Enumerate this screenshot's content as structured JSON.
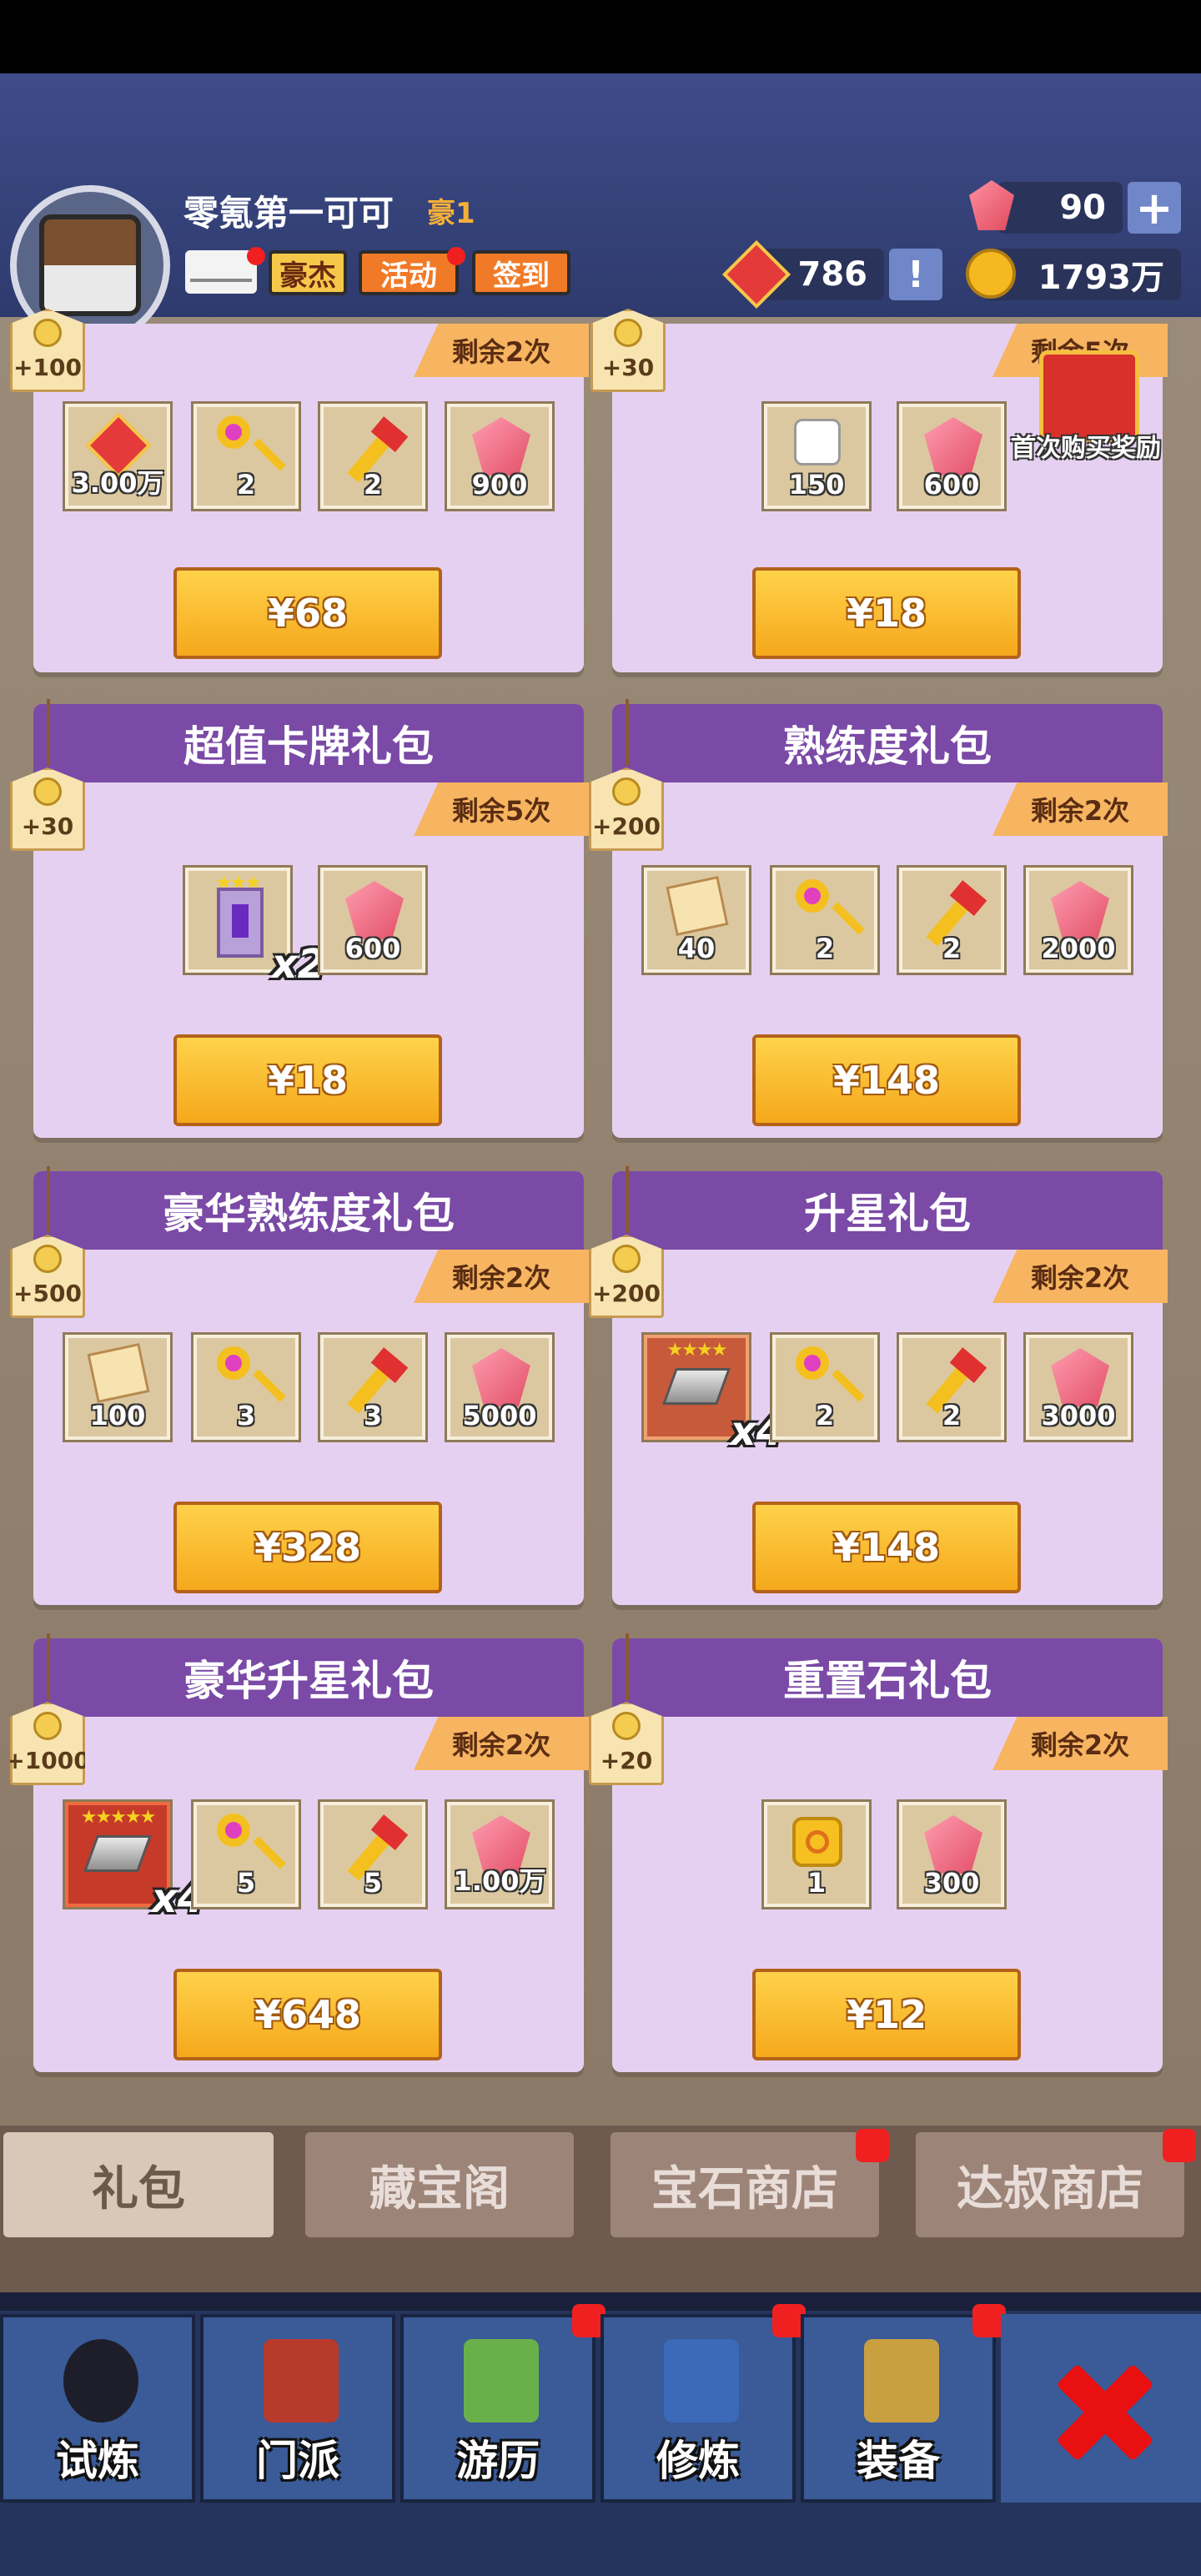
{
  "header": {
    "player_name": "零氪第一可可",
    "vip": "豪1",
    "buttons": {
      "haojie": "豪杰",
      "huodong": "活动",
      "qiandao": "签到"
    },
    "gems": "90",
    "honor": "786",
    "coins": "1793万"
  },
  "top_row": [
    {
      "tag": "+100",
      "remaining": "剩余2次",
      "items": [
        {
          "icon": "honor-icon",
          "qty": "3.00万"
        },
        {
          "icon": "pink-key-icon",
          "qty": "2"
        },
        {
          "icon": "gold-key-icon",
          "qty": "2"
        },
        {
          "icon": "gem-icon",
          "qty": "900"
        }
      ],
      "price": "¥68"
    },
    {
      "tag": "+30",
      "remaining": "剩余5次",
      "items": [
        {
          "icon": "dice-icon",
          "qty": "150"
        },
        {
          "icon": "gem-icon",
          "qty": "600"
        }
      ],
      "price": "¥18",
      "bonus_label": "首次购买奖励"
    }
  ],
  "packs": [
    {
      "title": "超值卡牌礼包",
      "tag": "+30",
      "remaining": "剩余5次",
      "items": [
        {
          "icon": "card-icon",
          "qty": "",
          "mult": "x2"
        },
        {
          "icon": "gem-icon",
          "qty": "600"
        }
      ],
      "price": "¥18"
    },
    {
      "title": "熟练度礼包",
      "tag": "+200",
      "remaining": "剩余2次",
      "items": [
        {
          "icon": "scroll-icon",
          "qty": "40"
        },
        {
          "icon": "pink-key-icon",
          "qty": "2"
        },
        {
          "icon": "gold-key-icon",
          "qty": "2"
        },
        {
          "icon": "gem-icon",
          "qty": "2000"
        }
      ],
      "price": "¥148"
    },
    {
      "title": "豪华熟练度礼包",
      "tag": "+500",
      "remaining": "剩余2次",
      "items": [
        {
          "icon": "scroll-icon",
          "qty": "100"
        },
        {
          "icon": "pink-key-icon",
          "qty": "3"
        },
        {
          "icon": "gold-key-icon",
          "qty": "3"
        },
        {
          "icon": "gem-icon",
          "qty": "5000"
        }
      ],
      "price": "¥328"
    },
    {
      "title": "升星礼包",
      "tag": "+200",
      "remaining": "剩余2次",
      "items": [
        {
          "icon": "ingot-icon",
          "qty": "",
          "mult": "x4",
          "stars": "★★★★"
        },
        {
          "icon": "pink-key-icon",
          "qty": "2"
        },
        {
          "icon": "gold-key-icon",
          "qty": "2"
        },
        {
          "icon": "gem-icon",
          "qty": "3000"
        }
      ],
      "price": "¥148"
    },
    {
      "title": "豪华升星礼包",
      "tag": "+1000",
      "remaining": "剩余2次",
      "items": [
        {
          "icon": "ingot-icon",
          "qty": "",
          "mult": "x4",
          "stars": "★★★★★"
        },
        {
          "icon": "pink-key-icon",
          "qty": "5"
        },
        {
          "icon": "gold-key-icon",
          "qty": "5"
        },
        {
          "icon": "gem-icon",
          "qty": "1.00万"
        }
      ],
      "price": "¥648"
    },
    {
      "title": "重置石礼包",
      "tag": "+20",
      "remaining": "剩余2次",
      "items": [
        {
          "icon": "swirl-icon",
          "qty": "1"
        },
        {
          "icon": "gem-icon",
          "qty": "300"
        }
      ],
      "price": "¥12"
    }
  ],
  "shop_tabs": [
    "礼包",
    "藏宝阁",
    "宝石商店",
    "达叔商店"
  ],
  "nav": [
    "试炼",
    "门派",
    "游历",
    "修炼",
    "装备"
  ],
  "colors": {
    "accent_purple": "#7a4aa6",
    "card_bg": "#e6d0f2",
    "price_btn": "#f5a81c",
    "badge_red": "#f02020"
  }
}
